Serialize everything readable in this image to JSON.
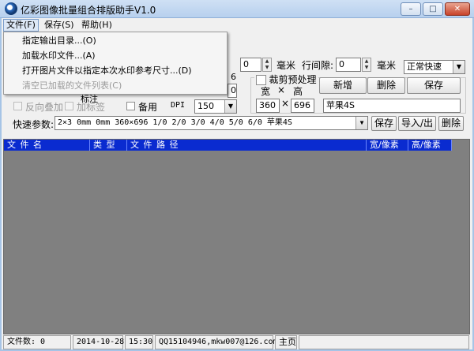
{
  "window": {
    "title": "亿彩图像批量组合排版助手V1.0",
    "minimize": "–",
    "maximize": "□",
    "close": "✕"
  },
  "menu": {
    "file": "文件(F)",
    "save": "保存(S)",
    "help": "帮助(H)"
  },
  "file_menu": {
    "items": [
      {
        "label": "指定输出目录...(O)",
        "enabled": true
      },
      {
        "label": "加载水印文件...(A)",
        "enabled": true
      },
      {
        "label": "打开图片文件以指定本次水印参考尺寸...(D)",
        "enabled": true
      },
      {
        "label": "清空已加载的文件列表(C)",
        "enabled": false
      }
    ]
  },
  "params": {
    "margin_value": "0",
    "margin_unit": "毫米",
    "row_gap_label": "行间隙:",
    "row_gap_value": "0",
    "row_gap_unit": "毫米",
    "speed_mode": "正常快速",
    "partial_value": "6",
    "partial_value2": "0",
    "partial_text": "标注"
  },
  "options": {
    "reverse_overlay": "反向叠加",
    "add_label": "加标签",
    "backup": "备用",
    "dpi_label": "DPI",
    "dpi_value": "150"
  },
  "crop": {
    "title": "裁剪预处理",
    "width_label": "宽",
    "times_sign": "×",
    "height_label": "高",
    "width_value": "360",
    "height_value": "696",
    "preset_name": "苹果4S",
    "add_button": "新增",
    "delete_button": "删除",
    "save_button": "保存"
  },
  "quick": {
    "label": "快速参数:",
    "value": "2×3 0mm 0mm 360×696 1/0 2/0 3/0 4/0 5/0 6/0 苹果4S",
    "save_button": "保存",
    "import_export_button": "导入/出",
    "delete_button": "删除"
  },
  "file_list": {
    "columns": [
      "文 件 名",
      "类 型",
      "文 件 路 径",
      "宽/像素",
      "高/像素"
    ],
    "rows": []
  },
  "status_bar": {
    "file_count": "文件数: 0",
    "date": "2014-10-28",
    "time": "15:30",
    "contact": "QQ15104946,mkw007@126.com",
    "homepage": "主页"
  }
}
